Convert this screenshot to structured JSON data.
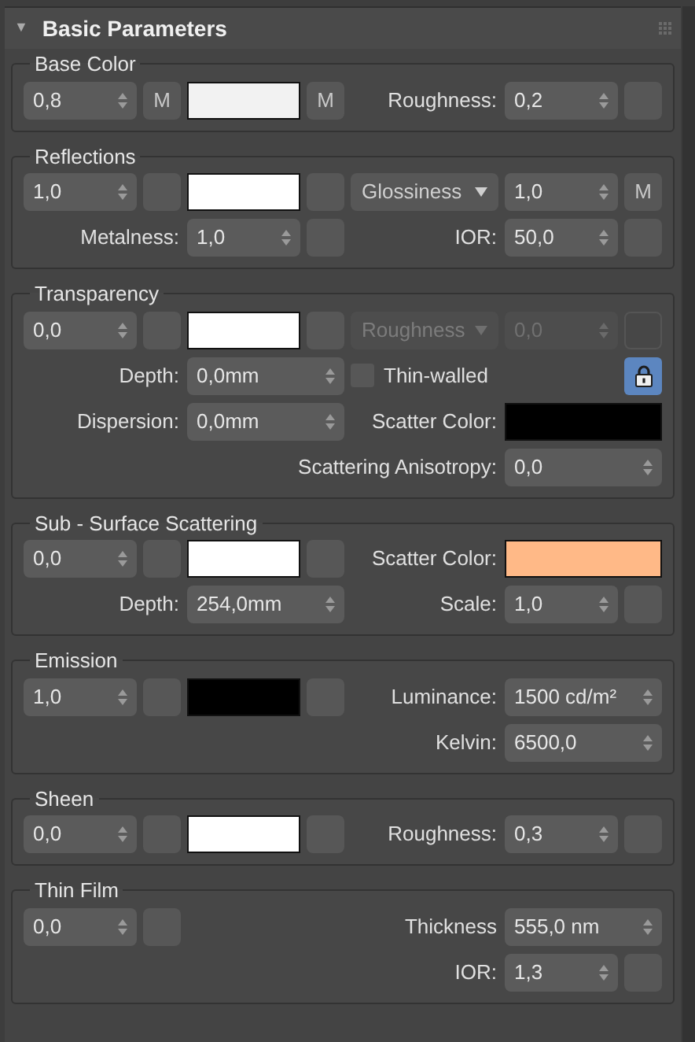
{
  "header": {
    "expander": "▼",
    "title": "Basic Parameters"
  },
  "groups": [
    {
      "title": "Base Color",
      "rows": [
        [
          {
            "kind": "spinner",
            "value": "0,8"
          },
          {
            "kind": "button",
            "label": "M"
          },
          {
            "kind": "swatch",
            "color": "#f2f2f2"
          },
          {
            "kind": "button",
            "label": "M"
          },
          {
            "kind": "label",
            "text": "Roughness:"
          },
          {
            "kind": "spinner",
            "value": "0,2"
          },
          {
            "kind": "button"
          }
        ]
      ]
    },
    {
      "title": "Reflections",
      "rows": [
        [
          {
            "kind": "spinner",
            "value": "1,0"
          },
          {
            "kind": "button"
          },
          {
            "kind": "swatch",
            "color": "#ffffff"
          },
          {
            "kind": "button"
          },
          {
            "kind": "dropdown",
            "value": "Glossiness",
            "disabled": false
          },
          {
            "kind": "spinner",
            "value": "1,0"
          },
          {
            "kind": "button",
            "label": "M"
          }
        ],
        [
          "",
          {
            "kind": "label",
            "text": "Metalness:"
          },
          {
            "kind": "spinner",
            "value": "1,0"
          },
          {
            "kind": "button"
          },
          {
            "kind": "label",
            "text": "IOR:"
          },
          {
            "kind": "spinner",
            "value": "50,0"
          },
          {
            "kind": "button"
          }
        ]
      ]
    },
    {
      "title": "Transparency",
      "rows": [
        [
          {
            "kind": "spinner",
            "value": "0,0"
          },
          {
            "kind": "button"
          },
          {
            "kind": "swatch",
            "color": "#ffffff"
          },
          {
            "kind": "button"
          },
          {
            "kind": "dropdown",
            "value": "Roughness",
            "disabled": true
          },
          {
            "kind": "spinner",
            "value": "0,0",
            "disabled": true
          },
          {
            "kind": "button",
            "disabled": true
          }
        ],
        [
          "",
          {
            "kind": "label",
            "text": "Depth:"
          },
          {
            "kind": "spinner",
            "value": "0,0mm"
          },
          "",
          {
            "kind": "checkbox",
            "text": "Thin-walled",
            "checked": false
          },
          "",
          {
            "kind": "lock",
            "on": true
          }
        ],
        [
          "",
          {
            "kind": "label",
            "text": "Dispersion:"
          },
          {
            "kind": "spinner",
            "value": "0,0mm"
          },
          "",
          {
            "kind": "label",
            "text": "Scatter Color:"
          },
          {
            "kind": "swatch",
            "color": "#000000"
          },
          ""
        ],
        [
          "",
          "",
          "",
          "",
          {
            "kind": "label",
            "text": "Scattering Anisotropy:"
          },
          {
            "kind": "spinner",
            "value": "0,0"
          },
          ""
        ]
      ]
    },
    {
      "title": "Sub - Surface Scattering",
      "rows": [
        [
          {
            "kind": "spinner",
            "value": "0,0"
          },
          {
            "kind": "button"
          },
          {
            "kind": "swatch",
            "color": "#ffffff"
          },
          {
            "kind": "button"
          },
          {
            "kind": "label",
            "text": "Scatter Color:"
          },
          {
            "kind": "swatch",
            "color": "#ffb987"
          },
          ""
        ],
        [
          "",
          {
            "kind": "label",
            "text": "Depth:"
          },
          {
            "kind": "spinner",
            "value": "254,0mm"
          },
          "",
          {
            "kind": "label",
            "text": "Scale:"
          },
          {
            "kind": "spinner",
            "value": "1,0"
          },
          {
            "kind": "button"
          }
        ]
      ]
    },
    {
      "title": "Emission",
      "rows": [
        [
          {
            "kind": "spinner",
            "value": "1,0"
          },
          {
            "kind": "button"
          },
          {
            "kind": "swatch",
            "color": "#000000"
          },
          {
            "kind": "button"
          },
          {
            "kind": "label",
            "text": "Luminance:"
          },
          {
            "kind": "spinner",
            "value": "1500 cd/m²"
          },
          ""
        ],
        [
          "",
          "",
          "",
          "",
          {
            "kind": "label",
            "text": "Kelvin:"
          },
          {
            "kind": "spinner",
            "value": "6500,0"
          },
          ""
        ]
      ]
    },
    {
      "title": "Sheen",
      "rows": [
        [
          {
            "kind": "spinner",
            "value": "0,0"
          },
          {
            "kind": "button"
          },
          {
            "kind": "swatch",
            "color": "#ffffff"
          },
          {
            "kind": "button"
          },
          {
            "kind": "label",
            "text": "Roughness:"
          },
          {
            "kind": "spinner",
            "value": "0,3"
          },
          {
            "kind": "button"
          }
        ]
      ]
    },
    {
      "title": "Thin Film",
      "rows": [
        [
          {
            "kind": "spinner",
            "value": "0,0"
          },
          {
            "kind": "button"
          },
          "",
          "",
          {
            "kind": "label",
            "text": "Thickness"
          },
          {
            "kind": "spinner",
            "value": "555,0 nm"
          },
          ""
        ],
        [
          "",
          "",
          "",
          "",
          {
            "kind": "label",
            "text": "IOR:"
          },
          {
            "kind": "spinner",
            "value": "1,3"
          },
          {
            "kind": "button"
          }
        ]
      ]
    }
  ]
}
